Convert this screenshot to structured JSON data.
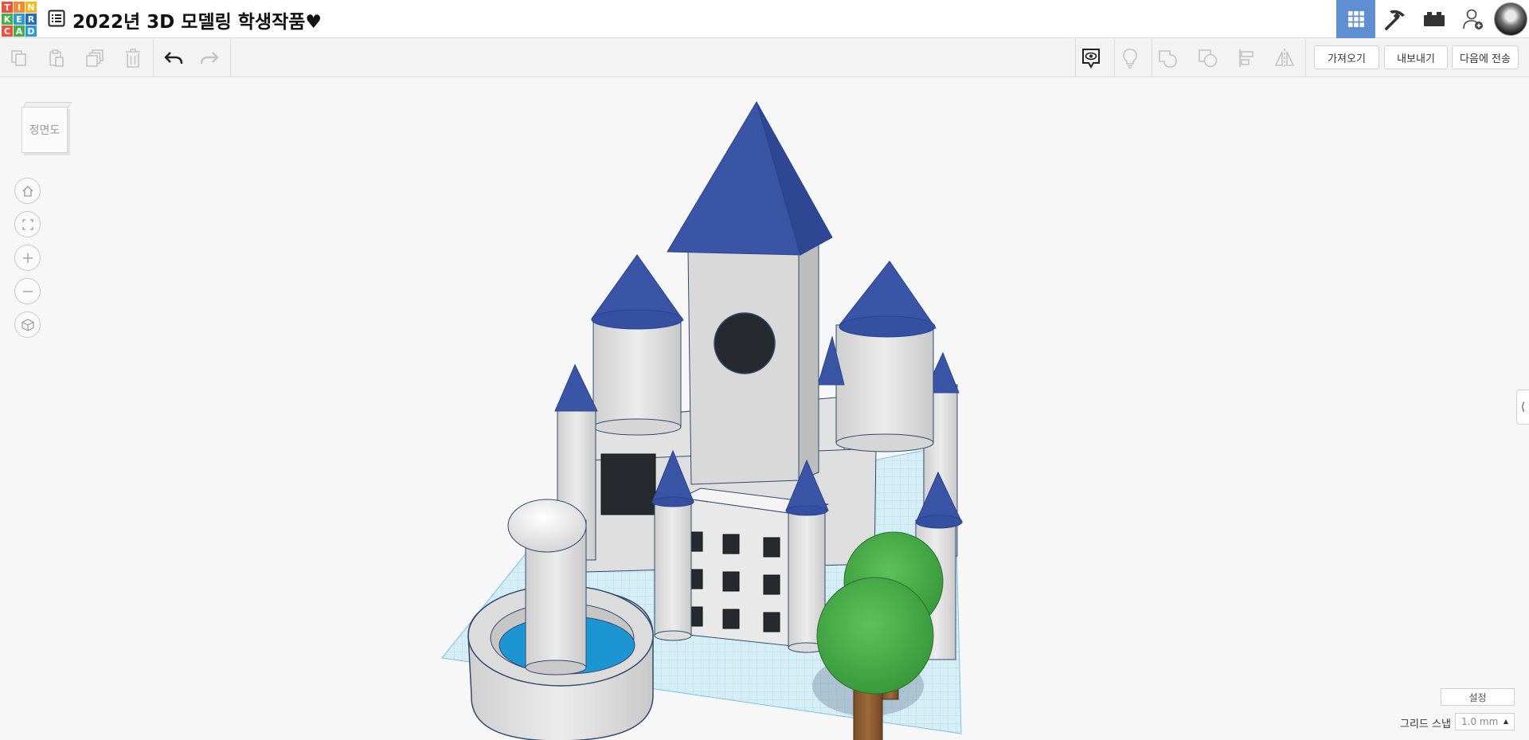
{
  "header": {
    "logo_letters": [
      "T",
      "I",
      "N",
      "K",
      "E",
      "R",
      "C",
      "A",
      "D"
    ],
    "logo_colors": [
      "#e8523f",
      "#f28b30",
      "#f5b81c",
      "#43b04a",
      "#2f9bd6",
      "#1d6fb8",
      "#e8523f",
      "#43b04a",
      "#2f9bd6"
    ],
    "design_list_icon": "list-icon",
    "design_title": "2022년 3D 모델링 학생작품♥",
    "right_buttons": [
      {
        "name": "3d-design-view",
        "icon": "grid-icon",
        "active": true
      },
      {
        "name": "blocks-view",
        "icon": "pickaxe-icon",
        "active": false
      },
      {
        "name": "bricks-view",
        "icon": "brick-icon",
        "active": false
      },
      {
        "name": "invite-user",
        "icon": "add-user-icon",
        "active": false
      }
    ]
  },
  "toolbar": {
    "left_tools": [
      {
        "name": "copy",
        "icon": "copy-icon"
      },
      {
        "name": "paste",
        "icon": "paste-icon"
      },
      {
        "name": "duplicate",
        "icon": "duplicate-icon"
      },
      {
        "name": "delete",
        "icon": "trash-icon"
      },
      {
        "name": "undo",
        "icon": "undo-icon"
      },
      {
        "name": "redo",
        "icon": "redo-icon"
      }
    ],
    "right_tools": [
      {
        "name": "notes",
        "icon": "note-eye-icon"
      },
      {
        "name": "show-hidden",
        "icon": "lightbulb-icon"
      },
      {
        "name": "group",
        "icon": "group-icon"
      },
      {
        "name": "ungroup",
        "icon": "ungroup-icon"
      },
      {
        "name": "align",
        "icon": "align-icon"
      },
      {
        "name": "mirror",
        "icon": "mirror-icon"
      }
    ],
    "import_label": "가져오기",
    "export_label": "내보내기",
    "send_to_label": "다음에 전송"
  },
  "viewcube": {
    "face_label": "정면도"
  },
  "nav_controls": [
    {
      "name": "home-view",
      "icon": "home-icon"
    },
    {
      "name": "fit-all",
      "icon": "fit-icon"
    },
    {
      "name": "zoom-in",
      "icon": "plus-icon"
    },
    {
      "name": "zoom-out",
      "icon": "minus-icon"
    },
    {
      "name": "perspective",
      "icon": "cube-icon"
    }
  ],
  "workplane": {
    "settings_label": "설정",
    "grid_snap_label": "그리드 스냅",
    "grid_snap_value": "1.0 mm"
  },
  "scene_colors": {
    "roof": "#3b55a6",
    "roof_dark": "#2c4290",
    "wall": "#d9d9d9",
    "wall_shade": "#c4c4c4",
    "window": "#26292d",
    "foliage": "#4cb04d",
    "foliage_dark": "#3a9a3c",
    "trunk": "#8a5a33",
    "water": "#1d95d3",
    "grid": "#bfe3f2",
    "outline": "#304a70"
  }
}
